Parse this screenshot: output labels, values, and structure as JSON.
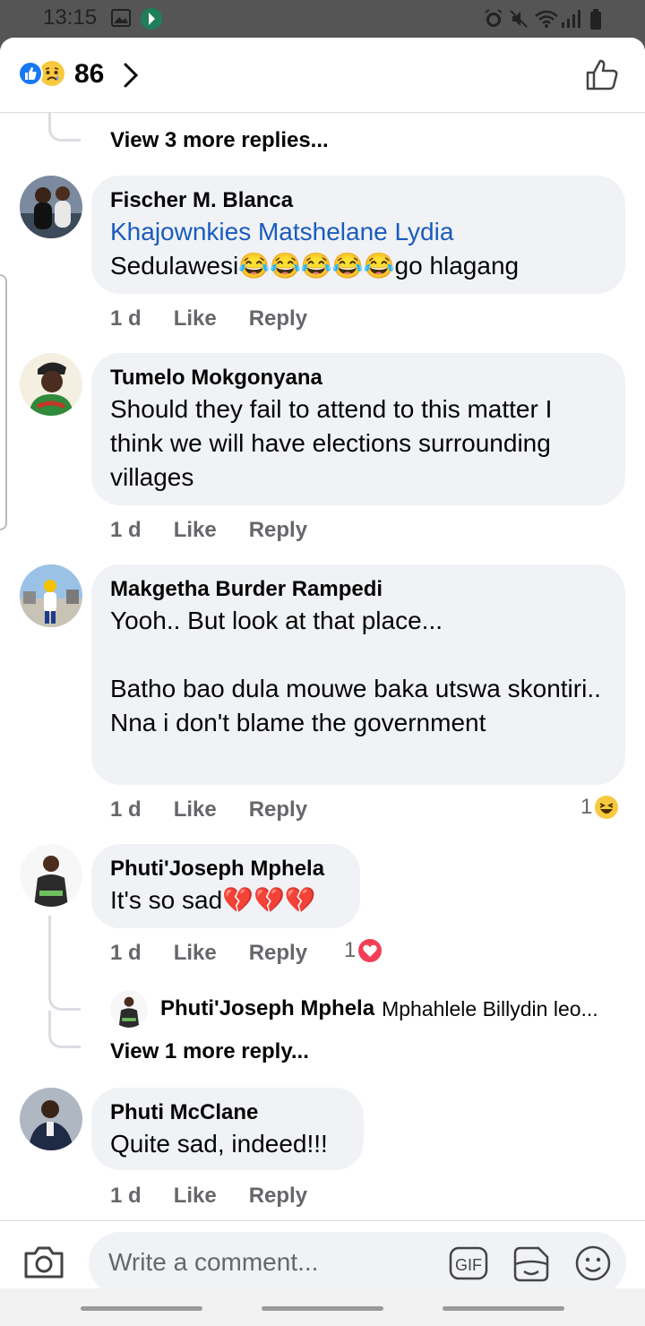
{
  "status_bar": {
    "time": "13:15",
    "icons": [
      "image-icon",
      "app-icon",
      "alarm-icon",
      "mute-icon",
      "wifi-icon",
      "signal-icon",
      "battery-icon"
    ]
  },
  "header": {
    "reactions": [
      "like-icon",
      "sad-icon"
    ],
    "count": "86"
  },
  "thread": {
    "view_more_top": "View 3 more replies...",
    "comments": [
      {
        "author": "Fischer M. Blanca",
        "mention": "Khajownkies Matshelane Lydia",
        "text": [
          "Sedulawesi😂😂😂😂😂go hlagang"
        ],
        "time": "1 d",
        "like": "Like",
        "reply": "Reply"
      },
      {
        "author": "Tumelo Mokgonyana",
        "text": [
          "Should they fail to attend to this matter I think we will have elections surrounding villages"
        ],
        "time": "1 d",
        "like": "Like",
        "reply": "Reply"
      },
      {
        "author": "Makgetha Burder Rampedi",
        "text": [
          "Yooh.. But look at that place...",
          "",
          "Batho bao dula mouwe baka utswa skontiri.. Nna i don't blame the government"
        ],
        "time": "1 d",
        "like": "Like",
        "reply": "Reply",
        "reaction_count": "1",
        "reaction_icon": "haha-icon"
      },
      {
        "author": "Phuti'Joseph Mphela",
        "text": [
          "It's so sad💔💔💔"
        ],
        "time": "1 d",
        "like": "Like",
        "reply": "Reply",
        "reaction_count": "1",
        "reaction_icon": "love-icon",
        "reply_preview": {
          "author": "Phuti'Joseph Mphela",
          "text": "Mphahlele Billydin leo..."
        },
        "view_more": "View 1 more reply..."
      },
      {
        "author": "Phuti McClane",
        "text": [
          "Quite sad, indeed!!!"
        ],
        "time": "1 d",
        "like": "Like",
        "reply": "Reply"
      }
    ]
  },
  "composer": {
    "placeholder": "Write a comment...",
    "gif_label": "GIF",
    "icons": [
      "camera-icon",
      "gif-icon",
      "sticker-icon",
      "emoji-icon"
    ]
  },
  "colors": {
    "accent": "#1877f2",
    "mention": "#1a5bbf",
    "bubble": "#f0f2f5",
    "secondary_text": "#65676b"
  }
}
